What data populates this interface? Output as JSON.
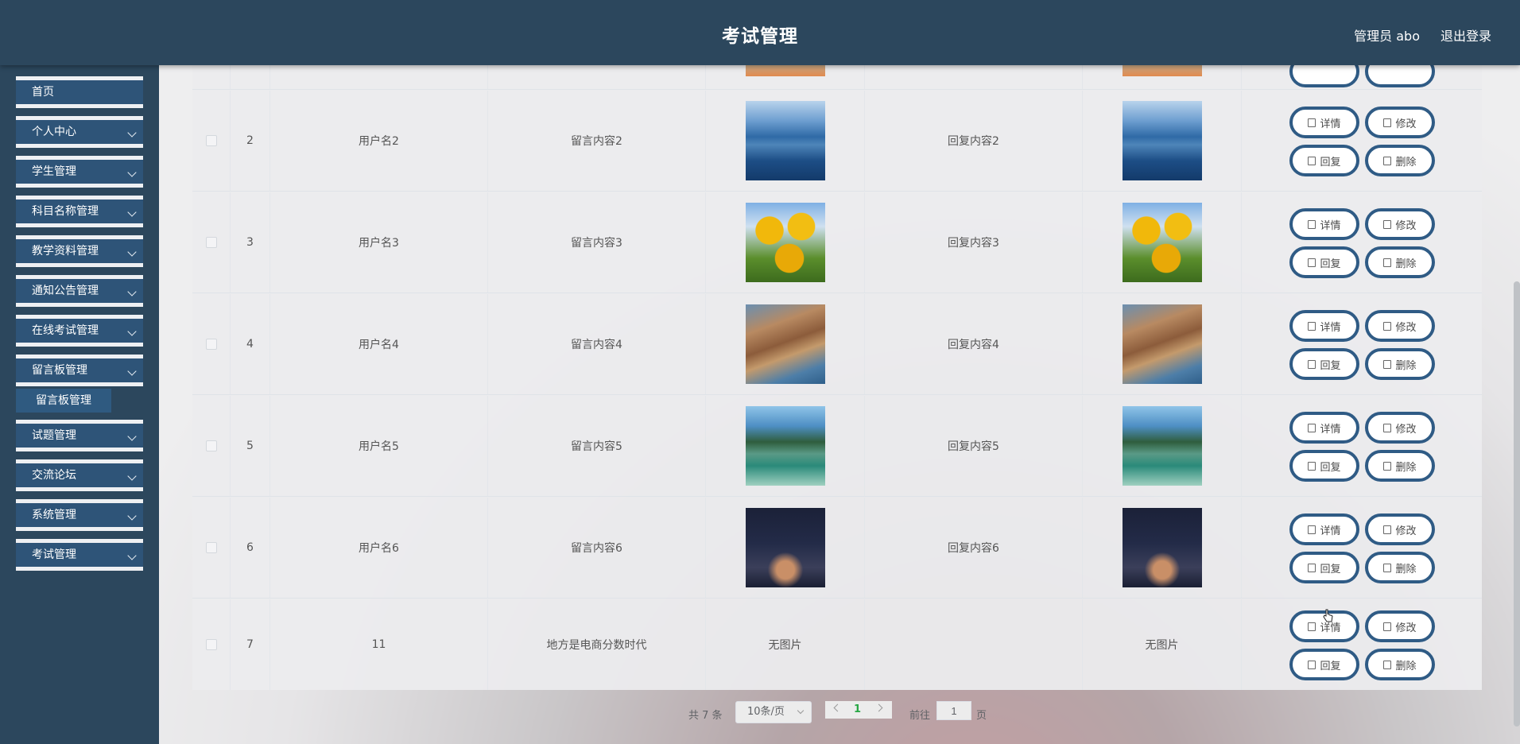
{
  "header": {
    "title": "考试管理",
    "user": "管理员 abo",
    "logout": "退出登录"
  },
  "sidebar": {
    "items": [
      {
        "label": "首页"
      },
      {
        "label": "个人中心"
      },
      {
        "label": "学生管理"
      },
      {
        "label": "科目名称管理"
      },
      {
        "label": "教学资料管理"
      },
      {
        "label": "通知公告管理"
      },
      {
        "label": "在线考试管理"
      },
      {
        "label": "留言板管理"
      },
      {
        "label": "试题管理"
      },
      {
        "label": "交流论坛"
      },
      {
        "label": "系统管理"
      },
      {
        "label": "考试管理"
      }
    ],
    "subitem": "留言板管理"
  },
  "table": {
    "rows": [
      {
        "index": "2",
        "username": "用户名2",
        "message": "留言内容2",
        "reply": "回复内容2",
        "image": "lake"
      },
      {
        "index": "3",
        "username": "用户名3",
        "message": "留言内容3",
        "reply": "回复内容3",
        "image": "sunflower"
      },
      {
        "index": "4",
        "username": "用户名4",
        "message": "留言内容4",
        "reply": "回复内容4",
        "image": "cliff-town"
      },
      {
        "index": "5",
        "username": "用户名5",
        "message": "留言内容5",
        "reply": "回复内容5",
        "image": "river-island"
      },
      {
        "index": "6",
        "username": "用户名6",
        "message": "留言内容6",
        "reply": "回复内容6",
        "image": "night-jar"
      },
      {
        "index": "7",
        "username": "11",
        "message": "地方是电商分数时代",
        "reply": "",
        "no_image": "无图片"
      }
    ],
    "actions": {
      "detail": "详情",
      "edit": "修改",
      "reply": "回复",
      "delete": "删除"
    }
  },
  "pagination": {
    "total": "共 7 条",
    "page_size": "10条/页",
    "current": "1",
    "goto": "前往",
    "goto_value": "1",
    "page_word": "页"
  },
  "colors": {
    "header": "#2c475d",
    "menu": "#2e5478",
    "button_border": "#2f5b85",
    "accent_green": "#28a745"
  }
}
